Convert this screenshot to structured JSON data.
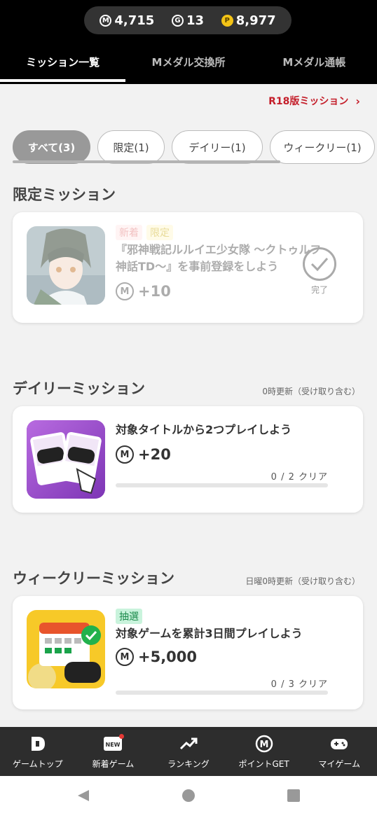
{
  "balances": {
    "m_medal": {
      "icon": "m-medal-icon",
      "value": "4,715",
      "symbol": "M"
    },
    "g_coin": {
      "icon": "g-coin-icon",
      "value": "13",
      "symbol": "G"
    },
    "p_point": {
      "icon": "p-point-icon",
      "value": "8,977",
      "symbol": "P"
    }
  },
  "tabs": [
    {
      "label": "ミッション一覧",
      "active": true
    },
    {
      "label": "Mメダル交換所",
      "active": false
    },
    {
      "label": "Mメダル通帳",
      "active": false
    }
  ],
  "r18_link": {
    "label": "R18版ミッション",
    "chevron": "›"
  },
  "filters": [
    {
      "label": "すべて(3)",
      "active": true
    },
    {
      "label": "限定(1)",
      "active": false
    },
    {
      "label": "デイリー(1)",
      "active": false
    },
    {
      "label": "ウィークリー(1)",
      "active": false
    }
  ],
  "sections": {
    "limited": {
      "title": "限定ミッション",
      "mission": {
        "badges": [
          "新着",
          "限定"
        ],
        "title": "『邪神戦記ルルイエ少女隊 〜クトゥルフ神話TD〜』を事前登録をしよう",
        "reward": "+10",
        "coin_symbol": "M",
        "status": "完了",
        "status_icon": "check"
      }
    },
    "daily": {
      "title": "デイリーミッション",
      "note": "0時更新（受け取り含む）",
      "mission": {
        "title": "対象タイトルから2つプレイしよう",
        "reward": "+20",
        "coin_symbol": "M",
        "progress_text": "0 / 2 クリア",
        "progress": 0
      }
    },
    "weekly": {
      "title": "ウィークリーミッション",
      "note": "日曜0時更新（受け取り含む）",
      "mission": {
        "badges": [
          "抽選"
        ],
        "title": "対象ゲームを累計3日間プレイしよう",
        "reward": "+5,000",
        "coin_symbol": "M",
        "progress_text": "0 / 3 クリア",
        "progress": 0
      }
    }
  },
  "bottom_nav": [
    {
      "label": "ゲームトップ",
      "icon": "game-top-icon",
      "glyph": "D"
    },
    {
      "label": "新着ゲーム",
      "icon": "new-games-icon",
      "glyph": "NEW"
    },
    {
      "label": "ランキング",
      "icon": "ranking-icon",
      "glyph": ""
    },
    {
      "label": "ポイントGET",
      "icon": "point-get-icon",
      "glyph": "M"
    },
    {
      "label": "マイゲーム",
      "icon": "my-games-icon",
      "glyph": ""
    }
  ],
  "colors": {
    "header_bg": "#000000",
    "accent_red": "#c41e2a",
    "nav_bg": "#2d2d2d"
  }
}
